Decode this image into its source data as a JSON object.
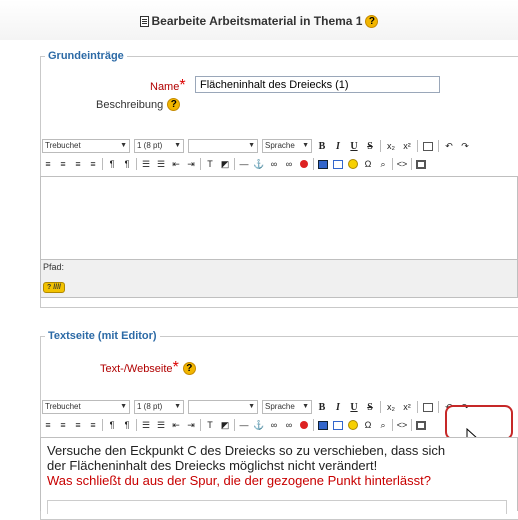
{
  "page": {
    "title": "Bearbeite Arbeitsmaterial in Thema 1"
  },
  "section1": {
    "legend": "Grundeinträge",
    "name_label": "Name",
    "name_value": "Flächeninhalt des Dreiecks (1)",
    "description_label": "Beschreibung",
    "path_label": "Pfad:"
  },
  "toolbar": {
    "font": "Trebuchet",
    "size": "1 (8 pt)",
    "format": "",
    "language": "Sprache",
    "bold": "B",
    "italic": "I",
    "underline": "U",
    "strike": "S",
    "subscript": "x₂",
    "superscript": "x²",
    "undo": "↶",
    "redo": "↷",
    "html_source": "<>",
    "icons": [
      "align-left-icon",
      "align-center-icon",
      "align-right-icon",
      "justify-icon",
      "ltr-icon",
      "rtl-icon",
      "ordered-list-icon",
      "unordered-list-icon",
      "outdent-icon",
      "indent-icon",
      "text-color-icon",
      "background-color-icon",
      "horizontal-rule-icon",
      "anchor-icon",
      "link-icon",
      "unlink-icon",
      "nolink-icon",
      "image-icon",
      "table-icon",
      "smiley-icon",
      "special-char-icon",
      "search-replace-icon",
      "html-source-icon",
      "fullscreen-icon"
    ]
  },
  "section2": {
    "legend": "Textseite (mit Editor)",
    "text_label": "Text-/Webseite",
    "content_line1": "Versuche den Eckpunkt C des Dreiecks so zu verschieben, dass sich",
    "content_line2": "der Flächeninhalt des Dreiecks möglichst nicht verändert!",
    "content_line3": "Was schließt du aus der Spur, die der gezogene Punkt hinterlässt?"
  },
  "colors": {
    "legend": "#2c6aa6",
    "required": "#b10000",
    "highlight": "#c62828",
    "question_text": "#c80000"
  }
}
